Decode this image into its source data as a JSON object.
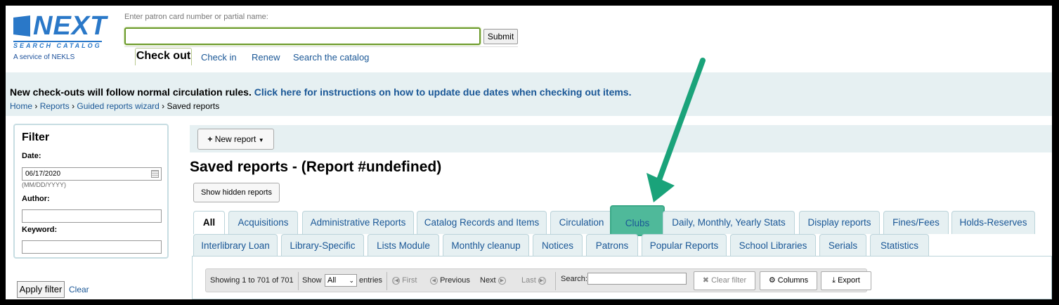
{
  "logo": {
    "word": "NEXT",
    "sub": "SEARCH CATALOG",
    "service": "A service of NEKLS"
  },
  "patron": {
    "label": "Enter patron card number or partial name:",
    "value": "",
    "submit": "Submit"
  },
  "circ_tabs": {
    "checkout": "Check out",
    "checkin": "Check in",
    "renew": "Renew",
    "search": "Search the catalog"
  },
  "banner": {
    "message": "New check-outs will follow normal circulation rules.",
    "link": "Click here for instructions on how to update due dates when checking out items."
  },
  "breadcrumb": {
    "home": "Home",
    "reports": "Reports",
    "wizard": "Guided reports wizard",
    "current": "Saved reports",
    "sep": "›"
  },
  "filter": {
    "title": "Filter",
    "date_label": "Date:",
    "date_value": "06/17/2020",
    "date_hint": "(MM/DD/YYYY)",
    "author_label": "Author:",
    "author_value": "",
    "keyword_label": "Keyword:",
    "keyword_value": "",
    "apply": "Apply filter",
    "clear": "Clear"
  },
  "toolbar": {
    "new_report": "New report",
    "page_title": "Saved reports - (Report #undefined)",
    "show_hidden": "Show hidden reports"
  },
  "tabs_row1": [
    "All",
    "Acquisitions",
    "Administrative Reports",
    "Catalog Records and Items",
    "Circulation",
    "Clubs",
    "Daily, Monthly, Yearly Stats",
    "Display reports",
    "Fines/Fees",
    "Holds-Reserves"
  ],
  "tabs_row2": [
    "Interlibrary Loan",
    "Library-Specific",
    "Lists Module",
    "Monthly cleanup",
    "Notices",
    "Patrons",
    "Popular Reports",
    "School Libraries",
    "Serials",
    "Statistics"
  ],
  "table": {
    "showing": "Showing 1 to 701 of 701",
    "show": "Show",
    "show_value": "All",
    "entries": "entries",
    "first": "First",
    "previous": "Previous",
    "next": "Next",
    "last": "Last",
    "search": "Search:",
    "search_value": "",
    "clear_filter": "Clear filter",
    "columns": "Columns",
    "export": "Export"
  },
  "colors": {
    "accent_link": "#1a5796",
    "highlight_tab": "#4fb99a",
    "arrow": "#1aa37a"
  }
}
